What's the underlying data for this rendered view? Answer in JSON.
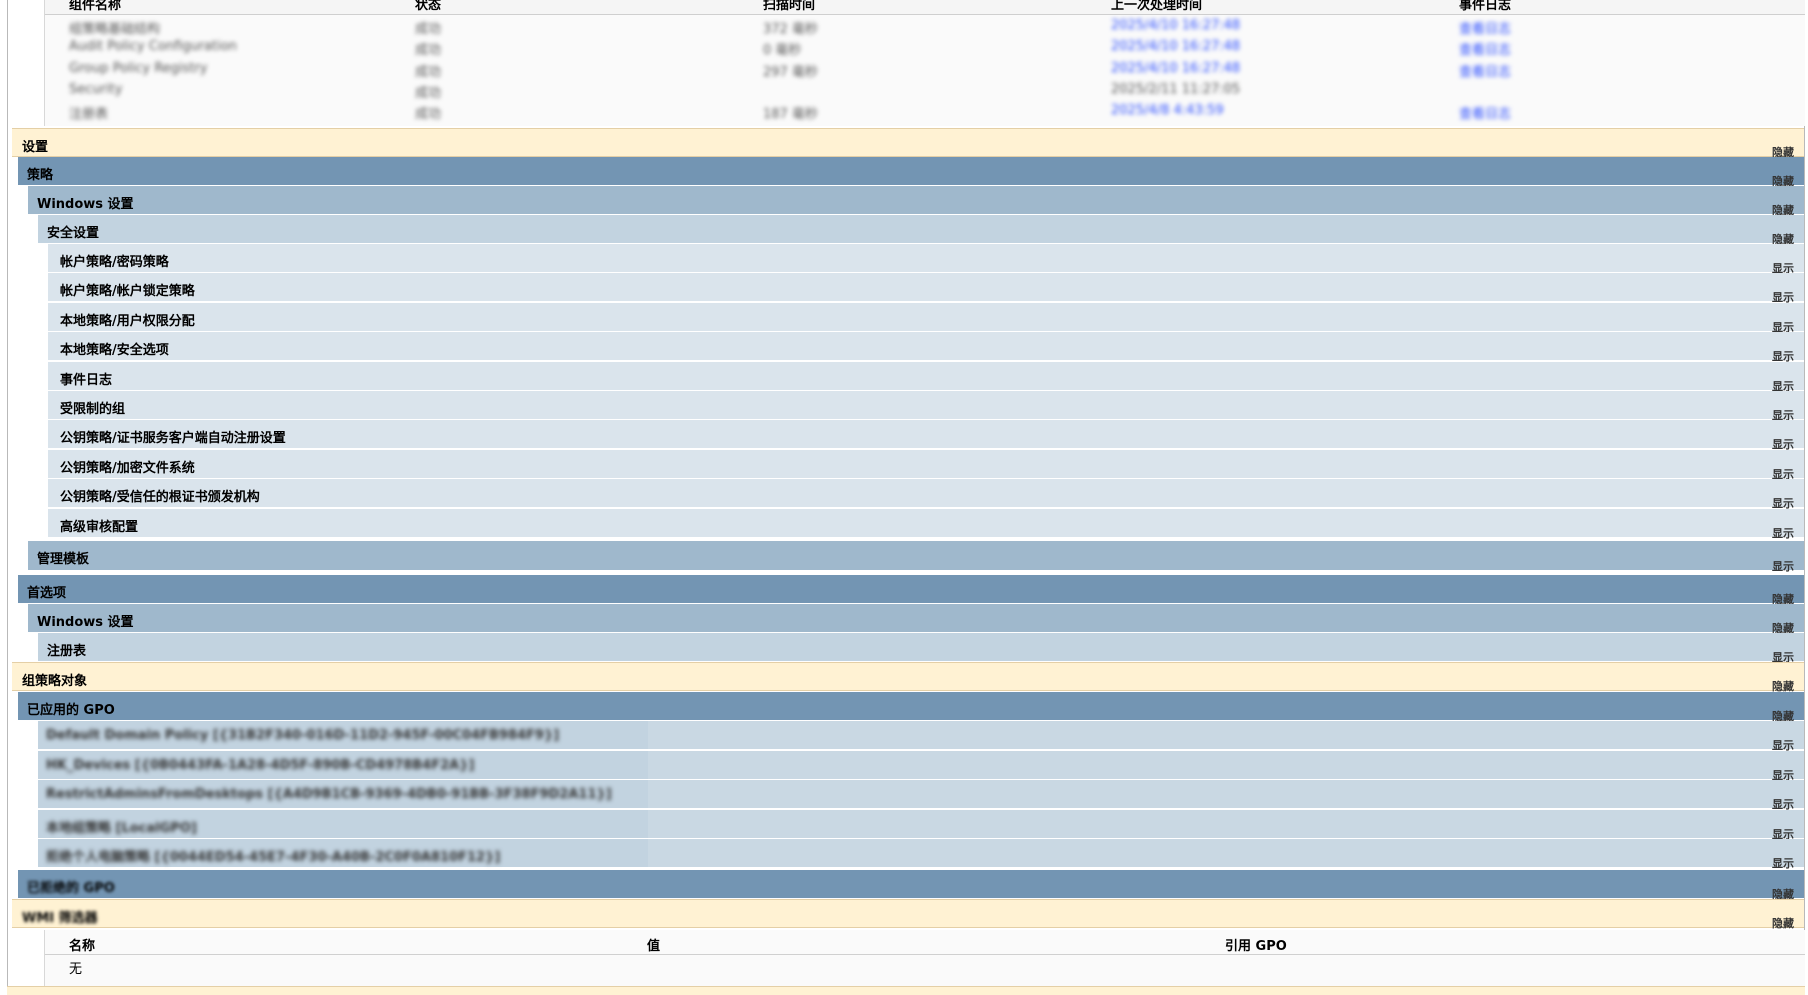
{
  "top_table": {
    "headers": [
      "组件名称",
      "状态",
      "扫描时间",
      "上一次处理时间",
      "事件日志"
    ],
    "rows": [
      [
        "组策略基础结构",
        "成功",
        "372 毫秒",
        "2025/4/10 16:27:48",
        "查看日志"
      ],
      [
        "Audit Policy Configuration",
        "成功",
        "0 毫秒",
        "2025/4/10 16:27:48",
        "查看日志"
      ],
      [
        "Group Policy Registry",
        "成功",
        "297 毫秒",
        "2025/4/10 16:27:48",
        "查看日志"
      ],
      [
        "Security",
        "成功",
        "",
        "2025/2/11 11:27:05",
        ""
      ],
      [
        "注册表",
        "成功",
        "187 毫秒",
        "2025/4/8 4:43:59",
        "查看日志"
      ]
    ]
  },
  "sections": [
    {
      "label": "设置",
      "toggle": "隐藏"
    },
    {
      "label": "策略",
      "toggle": "隐藏"
    },
    {
      "label": "Windows 设置",
      "toggle": "隐藏"
    },
    {
      "label": "安全设置",
      "toggle": "隐藏"
    },
    {
      "label": "帐户策略/密码策略",
      "toggle": "显示"
    },
    {
      "label": "帐户策略/帐户锁定策略",
      "toggle": "显示"
    },
    {
      "label": "本地策略/用户权限分配",
      "toggle": "显示"
    },
    {
      "label": "本地策略/安全选项",
      "toggle": "显示"
    },
    {
      "label": "事件日志",
      "toggle": "显示"
    },
    {
      "label": "受限制的组",
      "toggle": "显示"
    },
    {
      "label": "公钥策略/证书服务客户端自动注册设置",
      "toggle": "显示"
    },
    {
      "label": "公钥策略/加密文件系统",
      "toggle": "显示"
    },
    {
      "label": "公钥策略/受信任的根证书颁发机构",
      "toggle": "显示"
    },
    {
      "label": "高级审核配置",
      "toggle": "显示"
    },
    {
      "label": "管理模板",
      "toggle": "显示"
    },
    {
      "label": "首选项",
      "toggle": "隐藏"
    },
    {
      "label": "Windows 设置",
      "toggle": "隐藏"
    },
    {
      "label": "注册表",
      "toggle": "显示"
    },
    {
      "label": "组策略对象",
      "toggle": "隐藏"
    },
    {
      "label": "已应用的 GPO",
      "toggle": "隐藏"
    }
  ],
  "gpos": [
    {
      "label": "Default Domain Policy [{31B2F340-016D-11D2-945F-00C04FB984F9}]",
      "toggle": "显示"
    },
    {
      "label": "HK_Devices [{0B0443FA-1A28-4D5F-890B-CD4978B4F2A}]",
      "toggle": "显示"
    },
    {
      "label": "RestrictAdminsFromDesktops [{A4D9B1CB-9369-4DB0-91BB-3F38F9D2A11}]",
      "toggle": "显示"
    },
    {
      "label": "本地组策略 [LocalGPO]",
      "toggle": "显示"
    },
    {
      "label": "拒绝个人电脑策略 [{0044ED54-45E7-4F30-A40B-2C0F0A810F12}]",
      "toggle": "显示"
    }
  ],
  "after_sections": [
    {
      "label": "已拒绝的 GPO",
      "toggle": "隐藏"
    },
    {
      "label": "WMI 筛选器",
      "toggle": "隐藏"
    }
  ],
  "bottom_table": {
    "headers": [
      "名称",
      "值",
      "引用 GPO"
    ],
    "rows": [
      [
        "无",
        "",
        ""
      ]
    ]
  }
}
